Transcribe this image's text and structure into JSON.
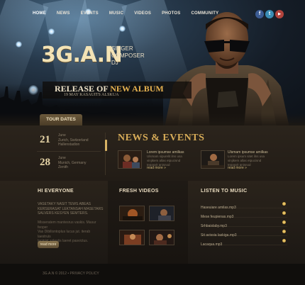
{
  "nav": {
    "items": [
      "HOME",
      "NEWS",
      "EVENTS",
      "MUSIC",
      "VIDEOS",
      "PHOTOS",
      "COMMUNITY"
    ],
    "social": [
      {
        "icon": "facebook-icon",
        "glyph": "f",
        "color": "#3b5b93"
      },
      {
        "icon": "twitter-icon",
        "glyph": "t",
        "color": "#3a8db5"
      },
      {
        "icon": "youtube-icon",
        "glyph": "▶",
        "color": "#b2433c"
      }
    ]
  },
  "hero": {
    "logo": "3G.A.N",
    "roles": [
      "SINGER",
      "COMPOSER",
      "DJ"
    ],
    "release_prefix": "RELEASE OF ",
    "release_highlight": "NEW ALBUM",
    "release_date": "19 MAY KASAUITS ALSKUA"
  },
  "tour": {
    "tab_label": "TOUR DATES",
    "dates": [
      {
        "day": "21",
        "lines": [
          "June",
          "Zurich, Switzerland",
          "Hallenstadion"
        ]
      },
      {
        "day": "28",
        "lines": [
          "June",
          "Munich, Germany",
          "Zenith"
        ]
      }
    ]
  },
  "news": {
    "title": "NEWS & EVENTS",
    "items": [
      {
        "title": "Lorem ipsumse amilkas",
        "text": [
          "Ulsmam sipurelit ilns usa",
          "vinjikem allas etpucisnd",
          "tepasvit anisnod"
        ],
        "more": "read more »"
      },
      {
        "title": "Ulsmam ipsumse amilkas",
        "text": [
          "Lorem ipsum sitet ilns usa",
          "vinjikem allas etpucisnd",
          "tepasvit anisnod"
        ],
        "more": "read more »"
      }
    ]
  },
  "hi": {
    "title": "HI EVERYONE",
    "text": [
      "VASETAKY NASIT TEWS ABEAS",
      "KERSERASAT LEKTANSAH MASETARS",
      "SALVERS KESYEN SEMTERS."
    ],
    "text2": [
      "Misseratem mantesrus vaskis. Masur feoper",
      "Vas Dibilisntoplus lucus jut. iterab laestruis",
      "laoinist solestis laeret pasvictus."
    ],
    "button": "read more"
  },
  "videos": {
    "title": "FRESH VIDEOS"
  },
  "music": {
    "title": "LISTEN TO MUSIC",
    "tracks": [
      "Haseuiare amilas.mp3",
      "Mese feupienas.mp3",
      "Srhbaislaby.mp3",
      "Sit avissia laskiga.mp3",
      "Lacaqua.mp3"
    ]
  },
  "footer": {
    "text": "3G.A.N © 2012 • PRIVACY POLICY"
  }
}
